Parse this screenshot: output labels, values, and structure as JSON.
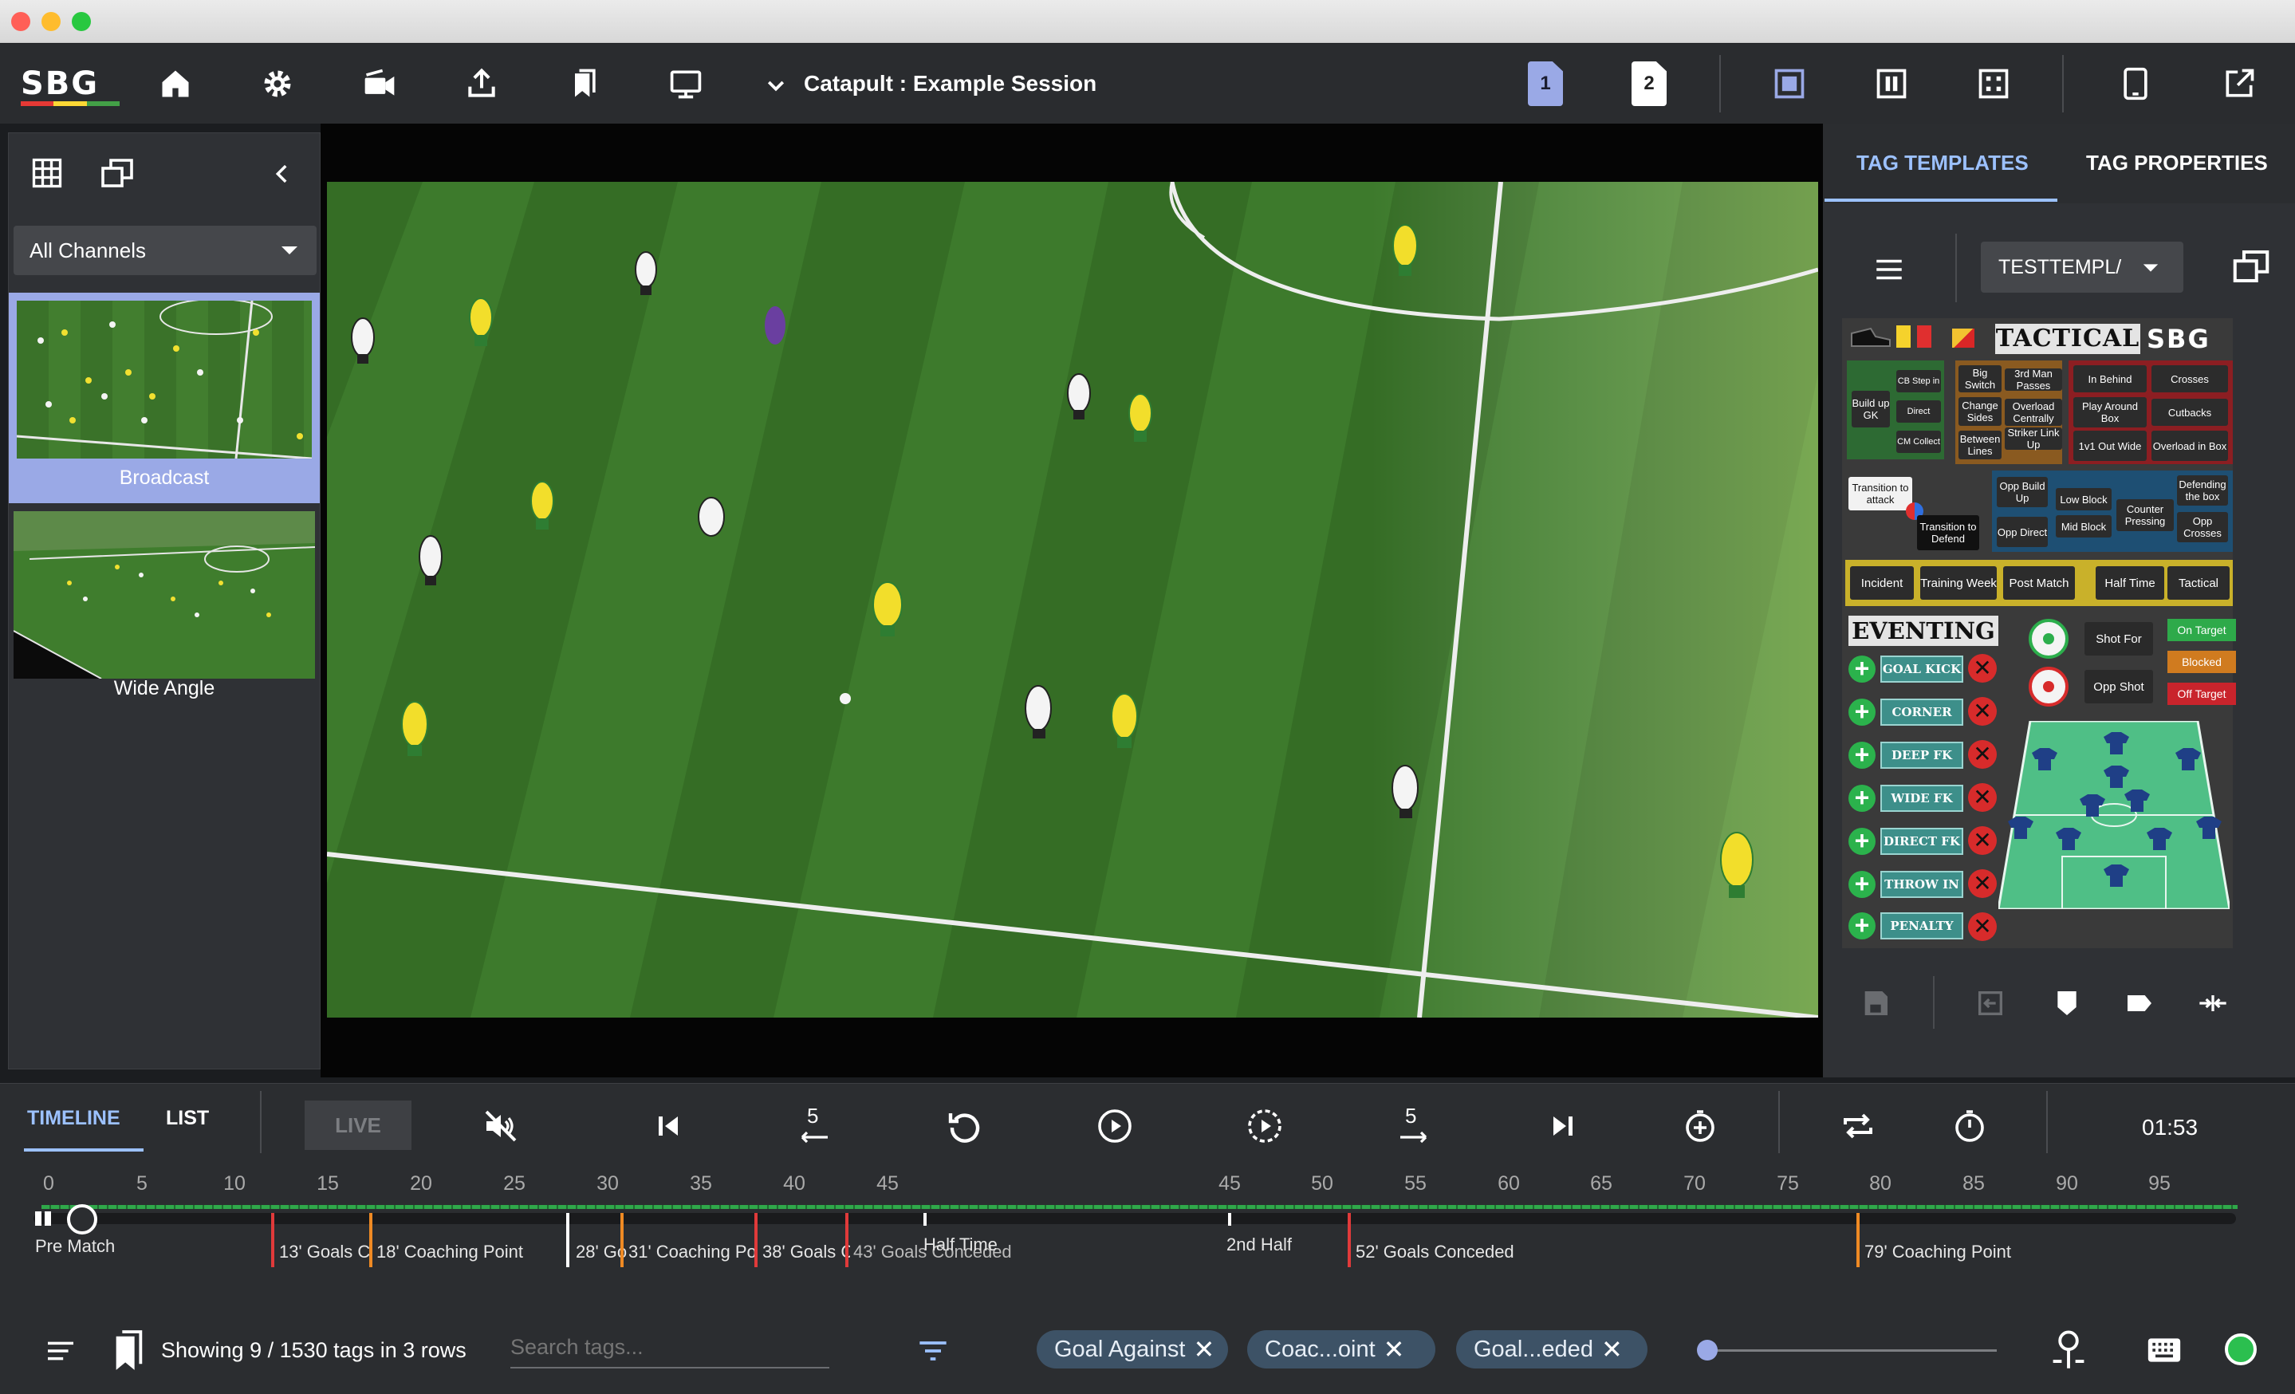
{
  "app": {
    "logo": "SBG",
    "session_title": "Catapult : Example Session",
    "page_buttons": [
      "1",
      "2"
    ]
  },
  "left_panel": {
    "channel_select": "All Channels",
    "channels": [
      {
        "label": "Broadcast",
        "selected": true
      },
      {
        "label": "Wide Angle",
        "selected": false
      }
    ]
  },
  "right_panel": {
    "tabs": [
      {
        "label": "TAG TEMPLATES",
        "active": true
      },
      {
        "label": "TAG PROPERTIES",
        "active": false
      }
    ],
    "template_select": "TESTTEMPL/",
    "tactical": {
      "heading": "TACTICAL",
      "logo": "SBG",
      "build_up": {
        "label": "Build up GK",
        "options": [
          "CB Step in",
          "Direct",
          "CM Collect"
        ]
      },
      "progression": [
        "Big Switch",
        "3rd Man Passes",
        "Change Sides",
        "Overload Centrally",
        "Between Lines",
        "Striker Link Up"
      ],
      "final_third": [
        "In Behind",
        "Crosses",
        "Play Around Box",
        "Cutbacks",
        "1v1 Out Wide",
        "Overload in Box"
      ],
      "transition_attack": "Transition to attack",
      "transition_defend": "Transition to Defend",
      "defending": [
        "Opp Build Up",
        "Low Block",
        "Counter Pressing",
        "Defending the box",
        "Opp Direct",
        "Mid Block",
        "Opp Crosses"
      ],
      "categories": [
        "Incident",
        "Training Week",
        "Post Match",
        "Half Time",
        "Tactical"
      ]
    },
    "eventing": {
      "heading": "EVENTING",
      "events": [
        "GOAL KICK",
        "CORNER",
        "DEEP FK",
        "WIDE FK",
        "DIRECT FK",
        "THROW IN",
        "PENALTY"
      ],
      "shots": [
        "Shot For",
        "Opp Shot"
      ],
      "outcomes": [
        "On Target",
        "Blocked",
        "Off Target"
      ]
    }
  },
  "transport": {
    "tabs": [
      {
        "label": "TIMELINE",
        "active": true
      },
      {
        "label": "LIST",
        "active": false
      }
    ],
    "live_label": "LIVE",
    "skip_back_seconds": "5",
    "skip_forward_seconds": "5",
    "clock": "01:53"
  },
  "timeline": {
    "first_half_ticks": [
      "0",
      "5",
      "10",
      "15",
      "20",
      "25",
      "30",
      "35",
      "40",
      "45"
    ],
    "second_half_ticks": [
      "45",
      "50",
      "55",
      "60",
      "65",
      "70",
      "75",
      "80",
      "85",
      "90",
      "95"
    ],
    "markers": [
      {
        "label": "Pre Match",
        "color": "#ffffff"
      },
      {
        "label": "13' Goals Co",
        "color": "#e03a3a"
      },
      {
        "label": "18' Coaching Point",
        "color": "#ef8a24"
      },
      {
        "label": "28' Go",
        "color": "#ffffff"
      },
      {
        "label": "31' Coaching Poi",
        "color": "#ef8a24"
      },
      {
        "label": "38' Goals C",
        "color": "#e03a3a"
      },
      {
        "label": "43' Goals Conceded",
        "color": "#e03a3a"
      },
      {
        "label": "Half Time",
        "color": "#ffffff"
      },
      {
        "label": "2nd Half",
        "color": "#ffffff"
      },
      {
        "label": "52' Goals Conceded",
        "color": "#e03a3a"
      },
      {
        "label": "79' Coaching Point",
        "color": "#ef8a24"
      }
    ]
  },
  "status_bar": {
    "tag_count_text": "Showing 9 / 1530 tags in 3 rows",
    "search_placeholder": "Search tags...",
    "filters": [
      "Goal Against",
      "Coac...oint",
      "Goal...eded"
    ]
  },
  "colors": {
    "accent": "#9aa9e6",
    "tab_active": "#9cc1ff",
    "status_ok": "#2bbf4f"
  }
}
